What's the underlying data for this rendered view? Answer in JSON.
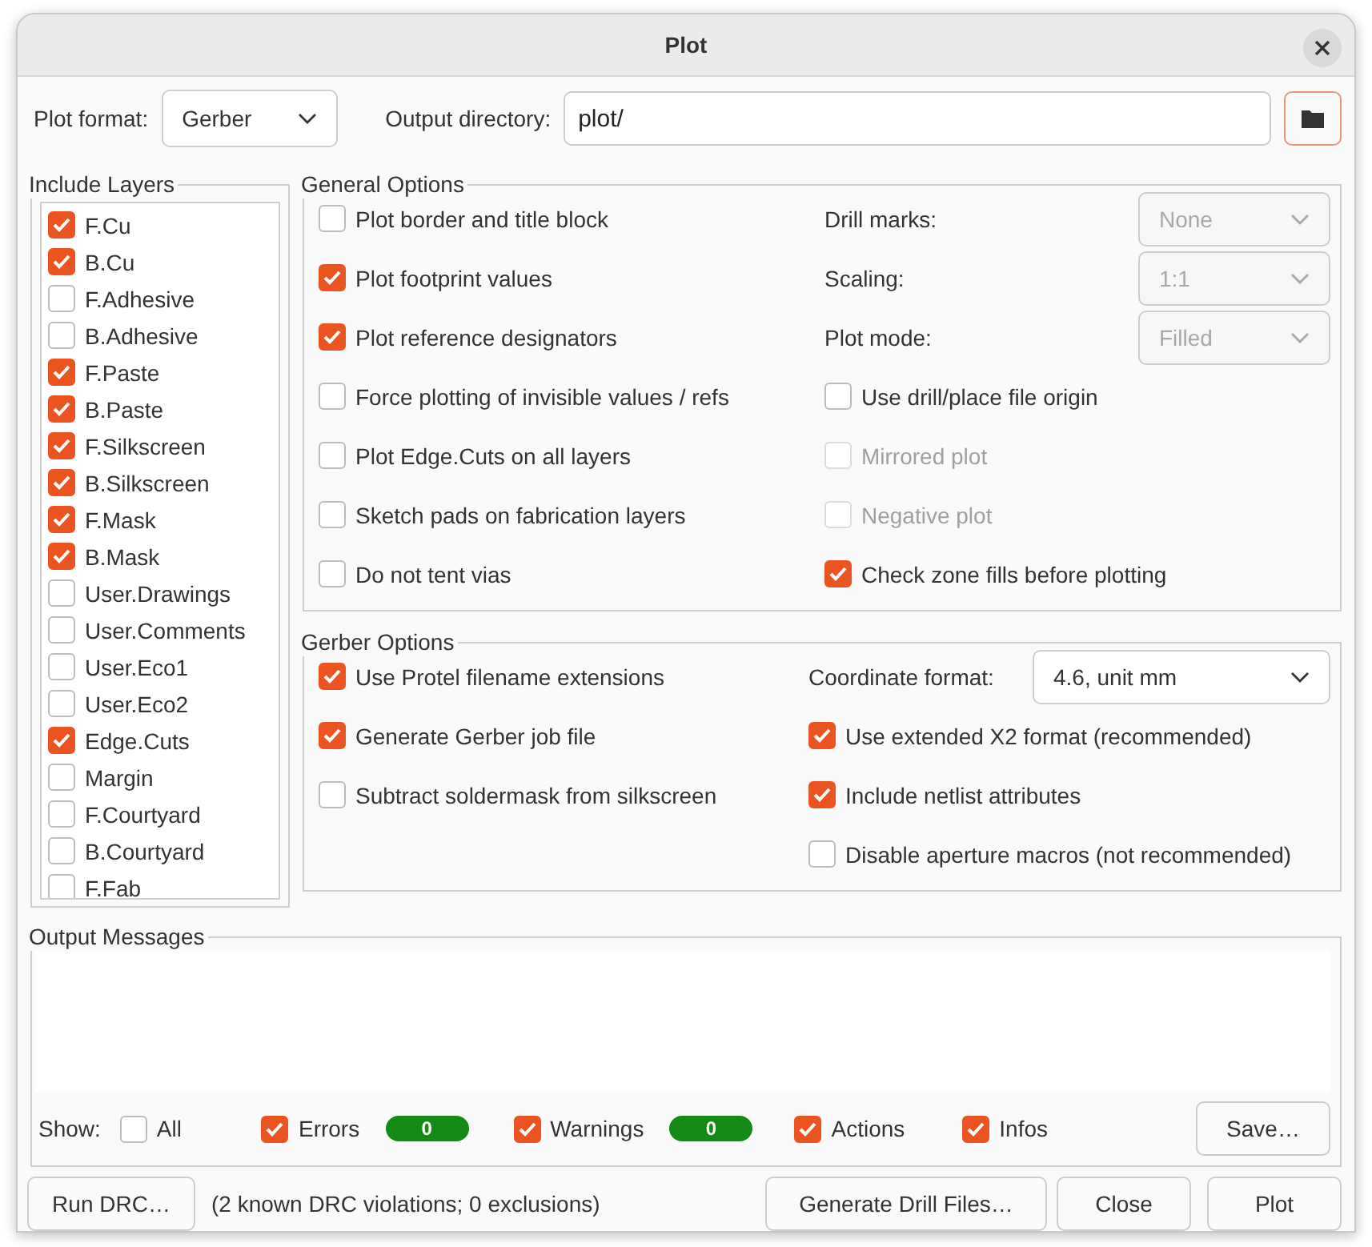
{
  "window": {
    "title": "Plot"
  },
  "plot_format": {
    "label": "Plot format:",
    "value": "Gerber"
  },
  "output_directory": {
    "label": "Output directory:",
    "value": "plot/"
  },
  "include_layers": {
    "title": "Include Layers",
    "layers": [
      {
        "name": "F.Cu",
        "checked": true
      },
      {
        "name": "B.Cu",
        "checked": true
      },
      {
        "name": "F.Adhesive",
        "checked": false
      },
      {
        "name": "B.Adhesive",
        "checked": false
      },
      {
        "name": "F.Paste",
        "checked": true
      },
      {
        "name": "B.Paste",
        "checked": true
      },
      {
        "name": "F.Silkscreen",
        "checked": true
      },
      {
        "name": "B.Silkscreen",
        "checked": true
      },
      {
        "name": "F.Mask",
        "checked": true
      },
      {
        "name": "B.Mask",
        "checked": true
      },
      {
        "name": "User.Drawings",
        "checked": false
      },
      {
        "name": "User.Comments",
        "checked": false
      },
      {
        "name": "User.Eco1",
        "checked": false
      },
      {
        "name": "User.Eco2",
        "checked": false
      },
      {
        "name": "Edge.Cuts",
        "checked": true
      },
      {
        "name": "Margin",
        "checked": false
      },
      {
        "name": "F.Courtyard",
        "checked": false
      },
      {
        "name": "B.Courtyard",
        "checked": false
      },
      {
        "name": "F.Fab",
        "checked": false
      }
    ]
  },
  "general_options": {
    "title": "General Options",
    "left": [
      {
        "label": "Plot border and title block",
        "checked": false
      },
      {
        "label": "Plot footprint values",
        "checked": true
      },
      {
        "label": "Plot reference designators",
        "checked": true
      },
      {
        "label": "Force plotting of invisible values / refs",
        "checked": false
      },
      {
        "label": "Plot Edge.Cuts on all layers",
        "checked": false
      },
      {
        "label": "Sketch pads on fabrication layers",
        "checked": false
      },
      {
        "label": "Do not tent vias",
        "checked": false
      }
    ],
    "right": [
      {
        "kind": "select",
        "label": "Drill marks:",
        "value": "None",
        "disabled": true
      },
      {
        "kind": "select",
        "label": "Scaling:",
        "value": "1:1",
        "disabled": true
      },
      {
        "kind": "select",
        "label": "Plot mode:",
        "value": "Filled",
        "disabled": true
      },
      {
        "kind": "checkbox",
        "label": "Use drill/place file origin",
        "checked": false,
        "disabled": false
      },
      {
        "kind": "checkbox",
        "label": "Mirrored plot",
        "checked": false,
        "disabled": true
      },
      {
        "kind": "checkbox",
        "label": "Negative plot",
        "checked": false,
        "disabled": true
      },
      {
        "kind": "checkbox",
        "label": "Check zone fills before plotting",
        "checked": true,
        "disabled": false
      }
    ]
  },
  "gerber_options": {
    "title": "Gerber Options",
    "left": [
      {
        "label": "Use Protel filename extensions",
        "checked": true
      },
      {
        "label": "Generate Gerber job file",
        "checked": true
      },
      {
        "label": "Subtract soldermask from silkscreen",
        "checked": false
      }
    ],
    "right": [
      {
        "kind": "select",
        "label": "Coordinate format:",
        "value": "4.6, unit mm",
        "disabled": false
      },
      {
        "kind": "checkbox",
        "label": "Use extended X2 format (recommended)",
        "checked": true,
        "disabled": false
      },
      {
        "kind": "checkbox",
        "label": "Include netlist attributes",
        "checked": true,
        "disabled": false
      },
      {
        "kind": "checkbox",
        "label": "Disable aperture macros (not recommended)",
        "checked": false,
        "disabled": false
      }
    ]
  },
  "output_messages": {
    "title": "Output Messages",
    "show_label": "Show:",
    "filters": [
      {
        "label": "All",
        "checked": false
      },
      {
        "label": "Errors",
        "checked": true,
        "count": "0"
      },
      {
        "label": "Warnings",
        "checked": true,
        "count": "0"
      },
      {
        "label": "Actions",
        "checked": true
      },
      {
        "label": "Infos",
        "checked": true
      }
    ],
    "save_button": "Save…"
  },
  "run_drc_button": "Run DRC…",
  "drc_status": "(2 known DRC violations; 0 exclusions)",
  "buttons": [
    "Generate Drill Files…",
    "Close",
    "Plot"
  ]
}
